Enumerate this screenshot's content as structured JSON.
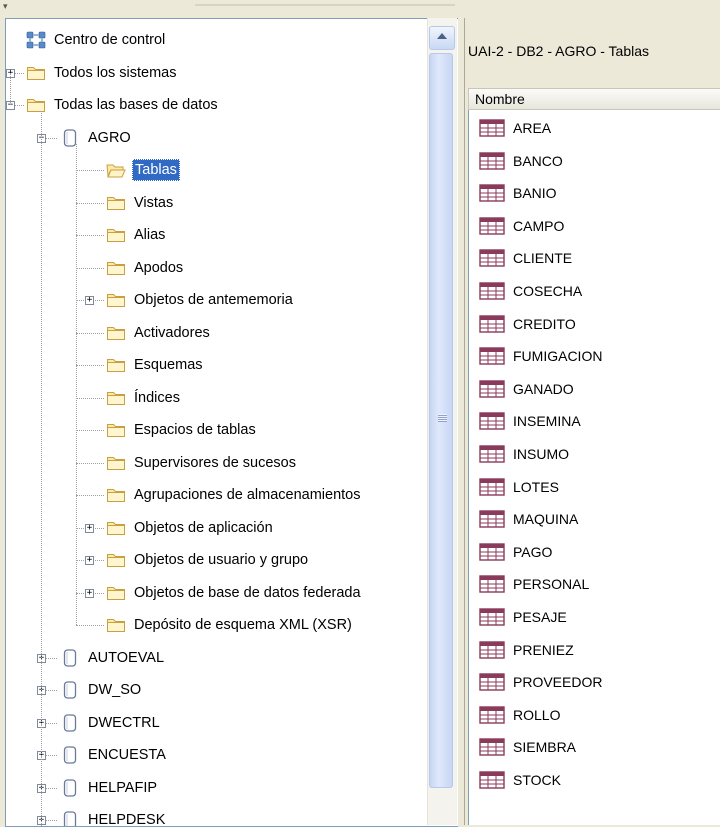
{
  "tree": {
    "nodes": [
      {
        "label": "Centro de control",
        "icon": "control-center-icon",
        "level": 0,
        "expander": "none"
      },
      {
        "label": "Todos los sistemas",
        "icon": "folder-icon",
        "level": 0,
        "expander": "plus"
      },
      {
        "label": "Todas las bases de datos",
        "icon": "folder-icon",
        "level": 0,
        "expander": "minus"
      },
      {
        "label": "AGRO",
        "icon": "database-icon",
        "level": 1,
        "expander": "minus"
      },
      {
        "label": "Tablas",
        "icon": "open-folder-icon",
        "level": 2,
        "expander": "none",
        "selected": true
      },
      {
        "label": "Vistas",
        "icon": "folder-icon",
        "level": 2,
        "expander": "none"
      },
      {
        "label": "Alias",
        "icon": "folder-icon",
        "level": 2,
        "expander": "none"
      },
      {
        "label": "Apodos",
        "icon": "folder-icon",
        "level": 2,
        "expander": "none"
      },
      {
        "label": "Objetos de antememoria",
        "icon": "folder-icon",
        "level": 2,
        "expander": "plus"
      },
      {
        "label": "Activadores",
        "icon": "folder-icon",
        "level": 2,
        "expander": "none"
      },
      {
        "label": "Esquemas",
        "icon": "folder-icon",
        "level": 2,
        "expander": "none"
      },
      {
        "label": "Índices",
        "icon": "folder-icon",
        "level": 2,
        "expander": "none"
      },
      {
        "label": "Espacios de tablas",
        "icon": "folder-icon",
        "level": 2,
        "expander": "none"
      },
      {
        "label": "Supervisores de sucesos",
        "icon": "folder-icon",
        "level": 2,
        "expander": "none"
      },
      {
        "label": "Agrupaciones de almacenamientos",
        "icon": "folder-icon",
        "level": 2,
        "expander": "none"
      },
      {
        "label": "Objetos de aplicación",
        "icon": "folder-icon",
        "level": 2,
        "expander": "plus"
      },
      {
        "label": "Objetos de usuario y grupo",
        "icon": "folder-icon",
        "level": 2,
        "expander": "plus"
      },
      {
        "label": "Objetos de base de datos federada",
        "icon": "folder-icon",
        "level": 2,
        "expander": "plus"
      },
      {
        "label": "Depósito de esquema XML (XSR)",
        "icon": "folder-icon",
        "level": 2,
        "expander": "none"
      },
      {
        "label": "AUTOEVAL",
        "icon": "database-icon",
        "level": 1,
        "expander": "plus"
      },
      {
        "label": "DW_SO",
        "icon": "database-icon",
        "level": 1,
        "expander": "plus"
      },
      {
        "label": "DWECTRL",
        "icon": "database-icon",
        "level": 1,
        "expander": "plus"
      },
      {
        "label": "ENCUESTA",
        "icon": "database-icon",
        "level": 1,
        "expander": "plus"
      },
      {
        "label": "HELPAFIP",
        "icon": "database-icon",
        "level": 1,
        "expander": "plus"
      },
      {
        "label": "HELPDESK",
        "icon": "database-icon",
        "level": 1,
        "expander": "plus"
      }
    ]
  },
  "panel": {
    "title": "UAI-2 - DB2 - AGRO - Tablas",
    "column_header": "Nombre",
    "tables": [
      "AREA",
      "BANCO",
      "BANIO",
      "CAMPO",
      "CLIENTE",
      "COSECHA",
      "CREDITO",
      "FUMIGACION",
      "GANADO",
      "INSEMINA",
      "INSUMO",
      "LOTES",
      "MAQUINA",
      "PAGO",
      "PERSONAL",
      "PESAJE",
      "PRENIEZ",
      "PROVEEDOR",
      "ROLLO",
      "SIEMBRA",
      "STOCK"
    ]
  },
  "colors": {
    "selection": "#316ac5",
    "folder_fill": "#fbe9a6",
    "folder_stroke": "#c8a040",
    "table_icon": "#8a3a5a",
    "database_icon": "#6b7a9a"
  }
}
